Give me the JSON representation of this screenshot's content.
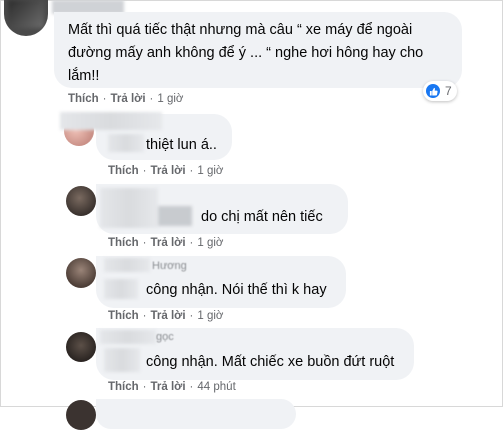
{
  "labels": {
    "like": "Thích",
    "reply": "Trả lời",
    "sep": "·"
  },
  "comments": [
    {
      "lines": [
        "Mất thì quá tiếc thật nhưng mà câu “ xe máy để ngoài",
        "đường mấy anh không để ý ... “ nghe hơi hông hay cho",
        "lắm!!"
      ],
      "time": "1 giờ",
      "reactions": {
        "count": "7",
        "icon": "like-icon"
      }
    },
    {
      "text": "thiệt lun á..",
      "time": "1 giờ"
    },
    {
      "text": "do chị mất nên tiếc",
      "time": "1 giờ"
    },
    {
      "name_fragment": "Hương",
      "text": "công nhận. Nói thế thì k hay",
      "time": "1 giờ"
    },
    {
      "name_fragment": "gọc",
      "text": "công nhận. Mất chiếc xe buồn đứt ruột",
      "time": "44 phút"
    }
  ],
  "colors": {
    "bubble": "#f0f2f5",
    "meta": "#65676b",
    "like_blue": "#1877f2"
  }
}
